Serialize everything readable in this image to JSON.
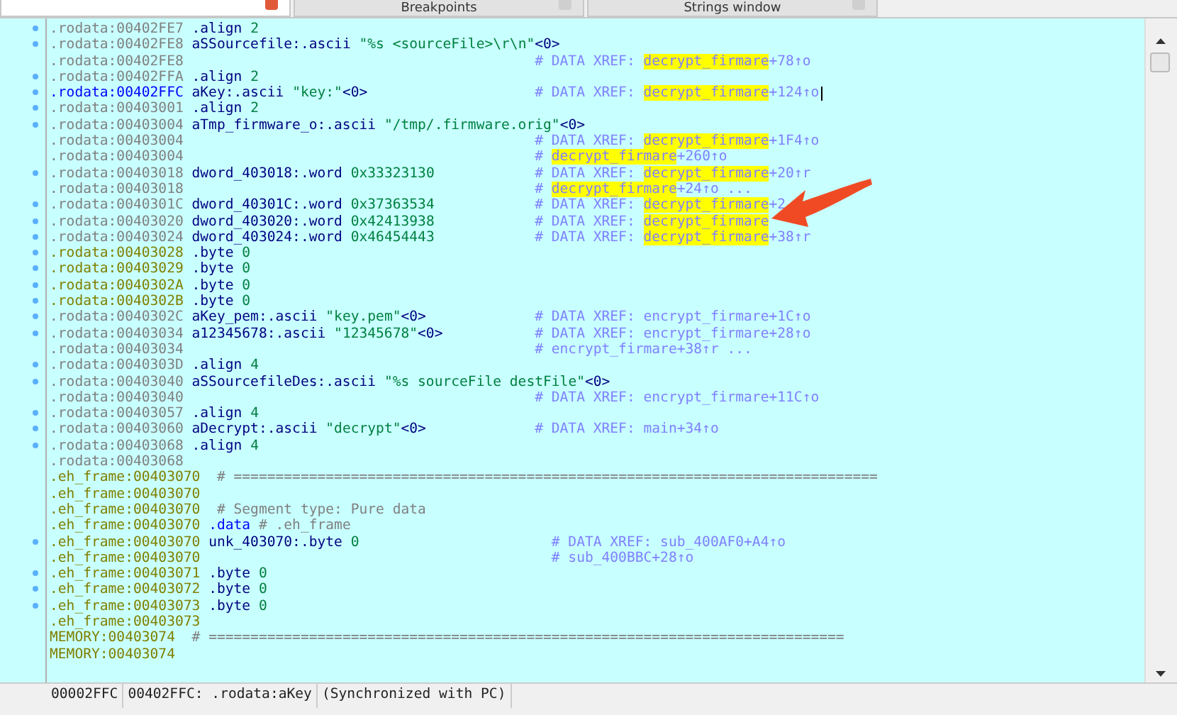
{
  "tabs": [
    {
      "selected": true
    },
    {
      "label": "Breakpoints",
      "selected": false
    },
    {
      "label": "Strings window",
      "selected": false
    }
  ],
  "listing": {
    "rows": [
      {
        "dot": true,
        "kind": "plain",
        "address": ".rodata:00402FE7",
        "code": [
          {
            "kind": "keyword",
            "text": ".align"
          },
          {
            "kind": "value",
            "text": "2"
          }
        ]
      },
      {
        "dot": true,
        "kind": "plain",
        "address": ".rodata:00402FE8",
        "code": [
          {
            "kind": "name",
            "text": "aSSourcefile:"
          },
          {
            "kind": "keyword",
            "text": ".ascii"
          },
          {
            "kind": "value",
            "text": "\"%s <sourceFile>\\r\\n\""
          },
          {
            "kind": "terminator",
            "text": "<0>"
          }
        ]
      },
      {
        "dot": false,
        "kind": "plain",
        "address": ".rodata:00402FE8",
        "comment": [
          {
            "kind": "plain",
            "text": "# DATA XREF:"
          },
          {
            "kind": "highlight",
            "text": "decrypt_firmare"
          },
          {
            "kind": "suffix",
            "text": "+78↑o"
          }
        ]
      },
      {
        "dot": true,
        "kind": "plain",
        "address": ".rodata:00402FFA",
        "code": [
          {
            "kind": "keyword",
            "text": ".align"
          },
          {
            "kind": "value",
            "text": "2"
          }
        ]
      },
      {
        "dot": true,
        "kind": "current",
        "address": ".rodata:00402FFC",
        "cursor": true,
        "code": [
          {
            "kind": "name",
            "text": "aKey:"
          },
          {
            "kind": "keyword",
            "text": ".ascii"
          },
          {
            "kind": "value",
            "text": "\"key:\""
          },
          {
            "kind": "terminator",
            "text": "<0>"
          }
        ],
        "comment": [
          {
            "kind": "plain",
            "text": "# DATA XREF:"
          },
          {
            "kind": "highlight",
            "text": "decrypt_firmare"
          },
          {
            "kind": "suffix",
            "text": "+124↑o"
          }
        ]
      },
      {
        "dot": true,
        "kind": "plain",
        "address": ".rodata:00403001",
        "code": [
          {
            "kind": "keyword",
            "text": ".align"
          },
          {
            "kind": "value",
            "text": "2"
          }
        ]
      },
      {
        "dot": true,
        "kind": "plain",
        "address": ".rodata:00403004",
        "code": [
          {
            "kind": "name",
            "text": "aTmp_firmware_o:"
          },
          {
            "kind": "keyword",
            "text": ".ascii"
          },
          {
            "kind": "value",
            "text": "\"/tmp/.firmware.orig\""
          },
          {
            "kind": "terminator",
            "text": "<0>"
          }
        ]
      },
      {
        "dot": false,
        "kind": "plain",
        "address": ".rodata:00403004",
        "comment": [
          {
            "kind": "plain",
            "text": "# DATA XREF:"
          },
          {
            "kind": "highlight",
            "text": "decrypt_firmare"
          },
          {
            "kind": "suffix",
            "text": "+1F4↑o"
          }
        ]
      },
      {
        "dot": false,
        "kind": "plain",
        "address": ".rodata:00403004",
        "comment": [
          {
            "kind": "plain",
            "text": "#"
          },
          {
            "kind": "highlight",
            "text": "decrypt_firmare"
          },
          {
            "kind": "suffix",
            "text": "+260↑o"
          }
        ]
      },
      {
        "dot": true,
        "kind": "plain",
        "address": ".rodata:00403018",
        "code": [
          {
            "kind": "name",
            "text": "dword_403018:"
          },
          {
            "kind": "keyword",
            "text": ".word"
          },
          {
            "kind": "value",
            "text": "0x33323130"
          }
        ],
        "comment": [
          {
            "kind": "plain",
            "text": "# DATA XREF:"
          },
          {
            "kind": "highlight",
            "text": "decrypt_firmare"
          },
          {
            "kind": "suffix",
            "text": "+20↑r"
          }
        ]
      },
      {
        "dot": false,
        "kind": "plain",
        "address": ".rodata:00403018",
        "comment": [
          {
            "kind": "plain",
            "text": "#"
          },
          {
            "kind": "highlight",
            "text": "decrypt_firmare"
          },
          {
            "kind": "suffix",
            "text": "+24↑o ..."
          }
        ]
      },
      {
        "dot": true,
        "kind": "plain",
        "address": ".rodata:0040301C",
        "code": [
          {
            "kind": "name",
            "text": "dword_40301C:"
          },
          {
            "kind": "keyword",
            "text": ".word"
          },
          {
            "kind": "value",
            "text": "0x37363534"
          }
        ],
        "comment": [
          {
            "kind": "plain",
            "text": "# DATA XREF:"
          },
          {
            "kind": "highlight",
            "text": "decrypt_firmare"
          },
          {
            "kind": "suffix",
            "text": "+2"
          }
        ]
      },
      {
        "dot": true,
        "kind": "plain",
        "address": ".rodata:00403020",
        "code": [
          {
            "kind": "name",
            "text": "dword_403020:"
          },
          {
            "kind": "keyword",
            "text": ".word"
          },
          {
            "kind": "value",
            "text": "0x42413938"
          }
        ],
        "comment": [
          {
            "kind": "plain",
            "text": "# DATA XREF:"
          },
          {
            "kind": "highlight",
            "text": "decrypt_firmare"
          }
        ]
      },
      {
        "dot": true,
        "kind": "plain",
        "address": ".rodata:00403024",
        "code": [
          {
            "kind": "name",
            "text": "dword_403024:"
          },
          {
            "kind": "keyword",
            "text": ".word"
          },
          {
            "kind": "value",
            "text": "0x46454443"
          }
        ],
        "comment": [
          {
            "kind": "plain",
            "text": "# DATA XREF:"
          },
          {
            "kind": "highlight",
            "text": "decrypt_firmare"
          },
          {
            "kind": "suffix",
            "text": "+38↑r"
          }
        ]
      },
      {
        "dot": true,
        "kind": "unexplored",
        "address": ".rodata:00403028",
        "code": [
          {
            "kind": "keyword",
            "text": ".byte"
          },
          {
            "kind": "value",
            "text": "0"
          }
        ]
      },
      {
        "dot": true,
        "kind": "unexplored",
        "address": ".rodata:00403029",
        "code": [
          {
            "kind": "keyword",
            "text": ".byte"
          },
          {
            "kind": "value",
            "text": "0"
          }
        ]
      },
      {
        "dot": true,
        "kind": "unexplored",
        "address": ".rodata:0040302A",
        "code": [
          {
            "kind": "keyword",
            "text": ".byte"
          },
          {
            "kind": "value",
            "text": "0"
          }
        ]
      },
      {
        "dot": true,
        "kind": "unexplored",
        "address": ".rodata:0040302B",
        "code": [
          {
            "kind": "keyword",
            "text": ".byte"
          },
          {
            "kind": "value",
            "text": "0"
          }
        ]
      },
      {
        "dot": true,
        "kind": "plain",
        "address": ".rodata:0040302C",
        "code": [
          {
            "kind": "name",
            "text": "aKey_pem:"
          },
          {
            "kind": "keyword",
            "text": ".ascii"
          },
          {
            "kind": "value",
            "text": "\"key.pem\""
          },
          {
            "kind": "terminator",
            "text": "<0>"
          }
        ],
        "comment": [
          {
            "kind": "plain",
            "text": "# DATA XREF: encrypt_firmare+1C↑o"
          }
        ]
      },
      {
        "dot": true,
        "kind": "plain",
        "address": ".rodata:00403034",
        "code": [
          {
            "kind": "name",
            "text": "a12345678:"
          },
          {
            "kind": "keyword",
            "text": ".ascii"
          },
          {
            "kind": "value",
            "text": "\"12345678\""
          },
          {
            "kind": "terminator",
            "text": "<0>"
          }
        ],
        "comment": [
          {
            "kind": "plain",
            "text": "# DATA XREF: encrypt_firmare+28↑o"
          }
        ]
      },
      {
        "dot": false,
        "kind": "plain",
        "address": ".rodata:00403034",
        "comment": [
          {
            "kind": "plain",
            "text": "# encrypt_firmare+38↑r ..."
          }
        ]
      },
      {
        "dot": true,
        "kind": "plain",
        "address": ".rodata:0040303D",
        "code": [
          {
            "kind": "keyword",
            "text": ".align"
          },
          {
            "kind": "value",
            "text": "4"
          }
        ]
      },
      {
        "dot": true,
        "kind": "plain",
        "address": ".rodata:00403040",
        "code": [
          {
            "kind": "name",
            "text": "aSSourcefileDes:"
          },
          {
            "kind": "keyword",
            "text": ".ascii"
          },
          {
            "kind": "value",
            "text": "\"%s sourceFile destFile\""
          },
          {
            "kind": "terminator",
            "text": "<0>"
          }
        ]
      },
      {
        "dot": false,
        "kind": "plain",
        "address": ".rodata:00403040",
        "comment": [
          {
            "kind": "plain",
            "text": "# DATA XREF: encrypt_firmare+11C↑o"
          }
        ]
      },
      {
        "dot": true,
        "kind": "plain",
        "address": ".rodata:00403057",
        "code": [
          {
            "kind": "keyword",
            "text": ".align"
          },
          {
            "kind": "value",
            "text": "4"
          }
        ]
      },
      {
        "dot": true,
        "kind": "plain",
        "address": ".rodata:00403060",
        "code": [
          {
            "kind": "name",
            "text": "aDecrypt:"
          },
          {
            "kind": "keyword",
            "text": ".ascii"
          },
          {
            "kind": "value",
            "text": "\"decrypt\""
          },
          {
            "kind": "terminator",
            "text": "<0>"
          }
        ],
        "comment": [
          {
            "kind": "plain",
            "text": "# DATA XREF: main+34↑o"
          }
        ]
      },
      {
        "dot": true,
        "kind": "plain",
        "address": ".rodata:00403068",
        "code": [
          {
            "kind": "keyword",
            "text": ".align"
          },
          {
            "kind": "value",
            "text": "4"
          }
        ]
      },
      {
        "dot": false,
        "kind": "plain",
        "address": ".rodata:00403068"
      },
      {
        "dot": false,
        "kind": "unexplored",
        "address": ".eh_frame:00403070",
        "code": [
          {
            "kind": "note",
            "text": " # ============================================================================="
          }
        ]
      },
      {
        "dot": false,
        "kind": "unexplored",
        "address": ".eh_frame:00403070"
      },
      {
        "dot": false,
        "kind": "unexplored",
        "address": ".eh_frame:00403070",
        "code": [
          {
            "kind": "note",
            "text": " # Segment type: Pure data"
          }
        ]
      },
      {
        "dot": false,
        "kind": "unexplored",
        "address": ".eh_frame:00403070",
        "code": [
          {
            "kind": "segdir",
            "text": ".data"
          },
          {
            "kind": "note",
            "text": "# .eh_frame"
          }
        ]
      },
      {
        "dot": true,
        "kind": "unexplored",
        "address": ".eh_frame:00403070",
        "code": [
          {
            "kind": "name",
            "text": "unk_403070:"
          },
          {
            "kind": "keyword",
            "text": ".byte"
          },
          {
            "kind": "value",
            "text": "0"
          }
        ],
        "comment": [
          {
            "kind": "plain",
            "text": "# DATA XREF: sub_400AF0+A4↑o"
          }
        ]
      },
      {
        "dot": false,
        "kind": "unexplored",
        "address": ".eh_frame:00403070",
        "comment": [
          {
            "kind": "plain",
            "text": "# sub_400BBC+28↑o"
          }
        ]
      },
      {
        "dot": true,
        "kind": "unexplored",
        "address": ".eh_frame:00403071",
        "code": [
          {
            "kind": "keyword",
            "text": ".byte"
          },
          {
            "kind": "value",
            "text": "0"
          }
        ]
      },
      {
        "dot": true,
        "kind": "unexplored",
        "address": ".eh_frame:00403072",
        "code": [
          {
            "kind": "keyword",
            "text": ".byte"
          },
          {
            "kind": "value",
            "text": "0"
          }
        ]
      },
      {
        "dot": true,
        "kind": "unexplored",
        "address": ".eh_frame:00403073",
        "code": [
          {
            "kind": "keyword",
            "text": ".byte"
          },
          {
            "kind": "value",
            "text": "0"
          }
        ]
      },
      {
        "dot": false,
        "kind": "unexplored",
        "address": ".eh_frame:00403073"
      },
      {
        "dot": false,
        "kind": "unexplored",
        "address": "MEMORY:00403074",
        "code": [
          {
            "kind": "note",
            "text": " # ============================================================================"
          }
        ]
      },
      {
        "dot": false,
        "kind": "unexplored",
        "address": "MEMORY:00403074"
      }
    ]
  },
  "status_bar": {
    "offset": "00002FFC",
    "location": "00402FFC: .rodata:aKey",
    "sync": "(Synchronized with PC)"
  }
}
